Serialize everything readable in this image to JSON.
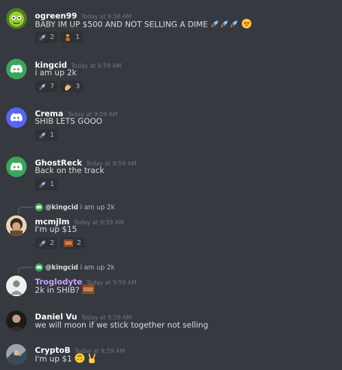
{
  "messages": [
    {
      "user": "ogreen99",
      "time": "Today at 9:58 AM",
      "text": "BABY IM UP $500 AND NOT SELLING A DIME",
      "reactions": [
        {
          "count": "2"
        },
        {
          "count": "1"
        }
      ]
    },
    {
      "user": "kingcid",
      "time": "Today at 9:59 AM",
      "text": "i am up 2k",
      "reactions": [
        {
          "count": "7"
        },
        {
          "count": "3"
        }
      ]
    },
    {
      "user": "Crema",
      "time": "Today at 9:59 AM",
      "text": "SHIB LETS GOOO",
      "reactions": [
        {
          "count": "1"
        }
      ]
    },
    {
      "user": "GhostReck",
      "time": "Today at 9:59 AM",
      "text": "Back on the track",
      "reactions": [
        {
          "count": "1"
        }
      ]
    },
    {
      "user": "mcmjlm",
      "time": "Today at 9:59 AM",
      "text": "I'm up $15",
      "reply_user": "@kingcid",
      "reply_text": "i am up 2k",
      "reactions": [
        {
          "count": "2"
        },
        {
          "count": "2"
        }
      ]
    },
    {
      "user": "Troglodyte",
      "time": "Today at 9:59 AM",
      "text": "2k in SHIB?",
      "reply_user": "@kingcid",
      "reply_text": "i am up 2k"
    },
    {
      "user": "Daniel Vu",
      "time": "Today at 9:59 AM",
      "text": "we will moon if we stick together not selling"
    },
    {
      "user": "CryptoB",
      "time": "Today at 9:59 AM",
      "text": "I'm up $1"
    }
  ],
  "colors": {
    "background": "#36393f",
    "username": "#ffffff",
    "username_role": "#c9a0ff",
    "discord_green": "#3ba55c",
    "discord_blue": "#5865f2"
  },
  "icons": {
    "reaction_emoji": "rocket-emoji",
    "avatar_default": "discord-logo-icon"
  }
}
